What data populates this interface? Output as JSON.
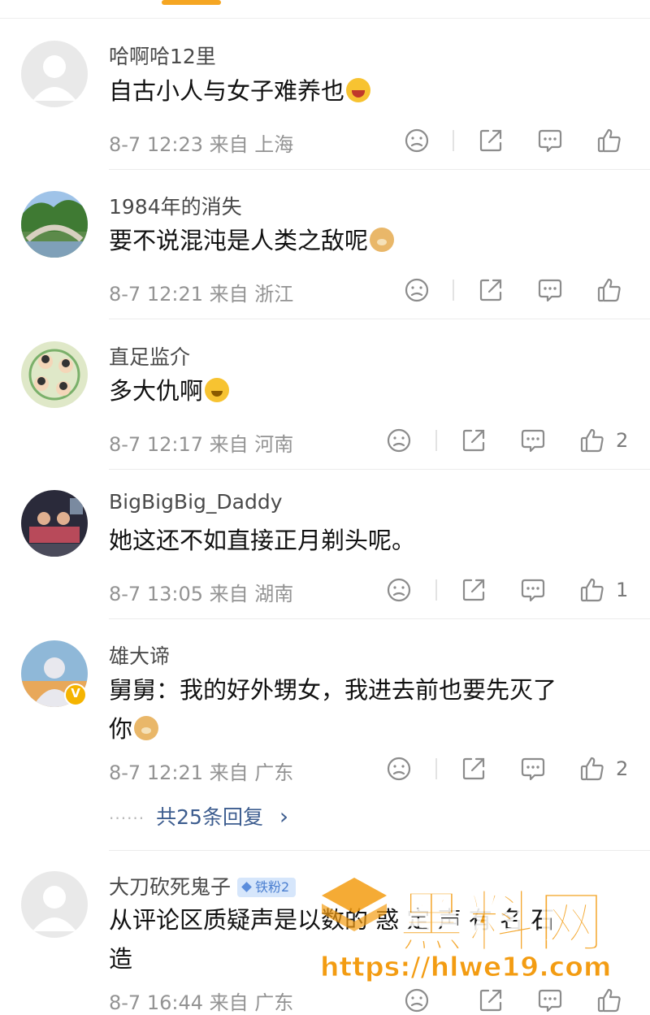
{
  "comments": [
    {
      "user": "哈啊哈12里",
      "text": "自古小人与女子难养也",
      "emoji": "laugh",
      "meta": "8-7 12:23 来自 上海",
      "likes": ""
    },
    {
      "user": "1984年的消失",
      "text": "要不说混沌是人类之敌呢",
      "emoji": "doge",
      "meta": "8-7 12:21 来自 浙江",
      "likes": ""
    },
    {
      "user": "直足监介",
      "text": "多大仇啊",
      "emoji": "cry-laugh",
      "meta": "8-7 12:17 来自 河南",
      "likes": "2"
    },
    {
      "user": "BigBigBig_Daddy",
      "text": "她这还不如直接正月剃头呢。",
      "emoji": "",
      "meta": "8-7 13:05 来自 湖南",
      "likes": "1"
    },
    {
      "user": "雄大谛",
      "text_line1": "舅舅：我的好外甥女，我进去前也要先灭了",
      "text_line2": "你",
      "emoji": "doge",
      "meta": "8-7 12:21 来自 广东",
      "likes": "2",
      "verified_badge": "V",
      "replies_label": "共25条回复",
      "replies_dots": "······",
      "replies_chevron": "›"
    },
    {
      "user": "大刀砍死鬼子",
      "fan_badge": "铁粉2",
      "text_line1": "从评论区质疑声是以数的 惑 定 声 有 名 石",
      "text_line2": "造",
      "meta": "8-7 16:44 来自 广东",
      "likes": ""
    }
  ],
  "watermark": {
    "name": "黑料网",
    "url": "https://hlwe19.com"
  },
  "colors": {
    "accent": "#f5a623",
    "link": "#3d5d8f",
    "meta": "#939393",
    "watermark": "#f39c12"
  },
  "icons": [
    "dislike-icon",
    "share-icon",
    "comment-icon",
    "like-icon"
  ]
}
